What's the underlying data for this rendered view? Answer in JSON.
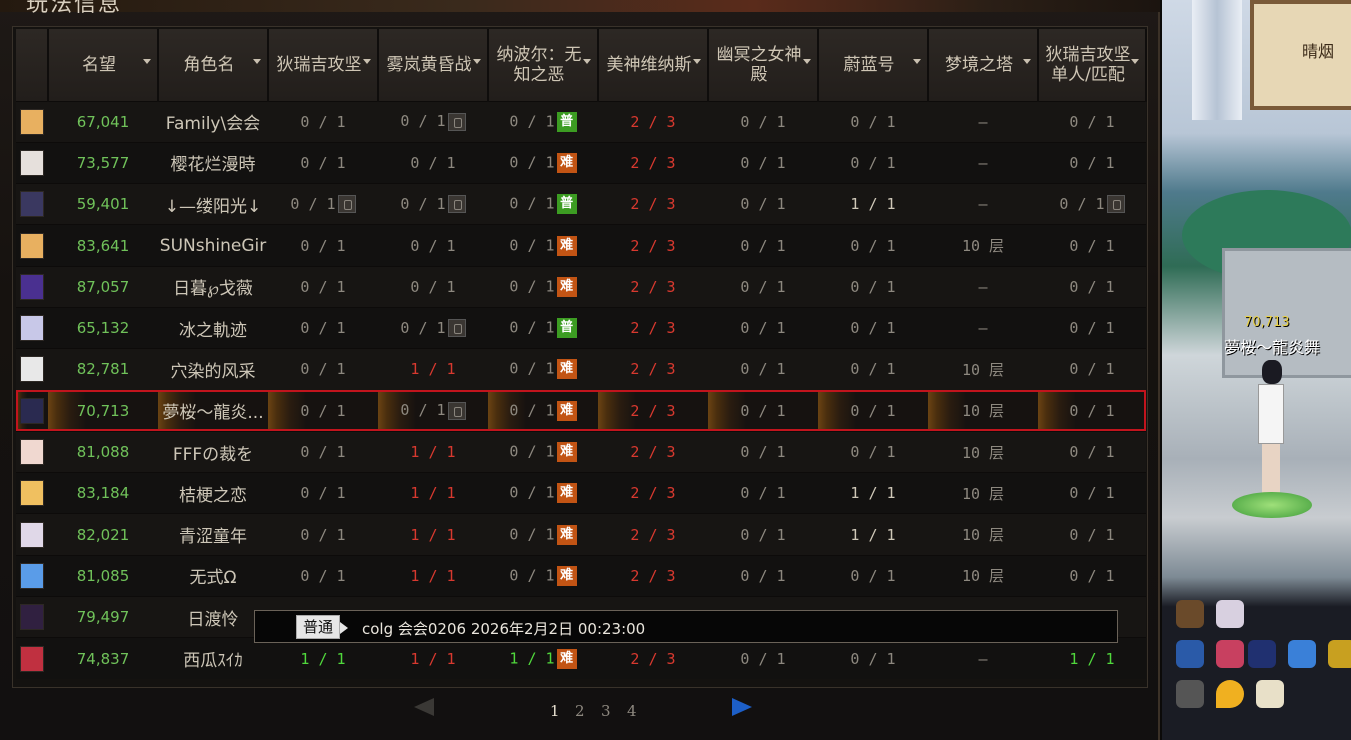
{
  "panel": {
    "title": "玩法信息"
  },
  "table": {
    "headers": [
      {
        "label": "",
        "name": "avatar"
      },
      {
        "label": "名望",
        "name": "fame"
      },
      {
        "label": "角色名",
        "name": "role-name"
      },
      {
        "label": "狄瑞吉攻坚",
        "name": "dirige-raid"
      },
      {
        "label": "雾岚黄昏战",
        "name": "mist-dusk"
      },
      {
        "label": "纳波尔：无知之恶",
        "name": "nabol"
      },
      {
        "label": "美神维纳斯",
        "name": "venus"
      },
      {
        "label": "幽冥之女神殿",
        "name": "nether-temple"
      },
      {
        "label": "蔚蓝号",
        "name": "azure"
      },
      {
        "label": "梦境之塔",
        "name": "dream-tower"
      },
      {
        "label": "狄瑞吉攻坚单人/匹配",
        "name": "dirige-solo"
      }
    ],
    "rows": [
      {
        "fame": "67,041",
        "name": "Family\\会会",
        "avatar_color": "#e8b060",
        "c1": {
          "v": "0 / 1"
        },
        "c2": {
          "v": "0 / 1",
          "lock": true
        },
        "c3": {
          "v": "0 / 1",
          "tag": "普",
          "tagType": "normal"
        },
        "c4": {
          "v": "2 / 3",
          "red": true
        },
        "c5": {
          "v": "0 / 1"
        },
        "c6": {
          "v": "0 / 1"
        },
        "c7": {
          "v": "–"
        },
        "c8": {
          "v": "0 / 1"
        }
      },
      {
        "fame": "73,577",
        "name": "樱花烂漫時",
        "avatar_color": "#e6e0dc",
        "c1": {
          "v": "0 / 1"
        },
        "c2": {
          "v": "0 / 1"
        },
        "c3": {
          "v": "0 / 1",
          "tag": "难",
          "tagType": "hard"
        },
        "c4": {
          "v": "2 / 3",
          "red": true
        },
        "c5": {
          "v": "0 / 1"
        },
        "c6": {
          "v": "0 / 1"
        },
        "c7": {
          "v": "–"
        },
        "c8": {
          "v": "0 / 1"
        }
      },
      {
        "fame": "59,401",
        "name": "↓—缕阳光↓",
        "avatar_color": "#3a3860",
        "c1": {
          "v": "0 / 1",
          "lock": true
        },
        "c2": {
          "v": "0 / 1",
          "lock": true
        },
        "c3": {
          "v": "0 / 1",
          "tag": "普",
          "tagType": "normal"
        },
        "c4": {
          "v": "2 / 3",
          "red": true
        },
        "c5": {
          "v": "0 / 1"
        },
        "c6": {
          "v": "1 / 1",
          "bright": true
        },
        "c7": {
          "v": "–"
        },
        "c8": {
          "v": "0 / 1",
          "lock": true
        }
      },
      {
        "fame": "83,641",
        "name": "SUNshineGir",
        "avatar_color": "#e8b060",
        "c1": {
          "v": "0 / 1"
        },
        "c2": {
          "v": "0 / 1"
        },
        "c3": {
          "v": "0 / 1",
          "tag": "难",
          "tagType": "hard"
        },
        "c4": {
          "v": "2 / 3",
          "red": true
        },
        "c5": {
          "v": "0 / 1"
        },
        "c6": {
          "v": "0 / 1"
        },
        "c7": {
          "v": "10 层"
        },
        "c8": {
          "v": "0 / 1"
        }
      },
      {
        "fame": "87,057",
        "name": "日暮℘戈薇",
        "avatar_color": "#4a3090",
        "c1": {
          "v": "0 / 1"
        },
        "c2": {
          "v": "0 / 1"
        },
        "c3": {
          "v": "0 / 1",
          "tag": "难",
          "tagType": "hard"
        },
        "c4": {
          "v": "2 / 3",
          "red": true
        },
        "c5": {
          "v": "0 / 1"
        },
        "c6": {
          "v": "0 / 1"
        },
        "c7": {
          "v": "–"
        },
        "c8": {
          "v": "0 / 1"
        }
      },
      {
        "fame": "65,132",
        "name": "冰之軌迹",
        "avatar_color": "#c8c8e8",
        "c1": {
          "v": "0 / 1"
        },
        "c2": {
          "v": "0 / 1",
          "lock": true
        },
        "c3": {
          "v": "0 / 1",
          "tag": "普",
          "tagType": "normal"
        },
        "c4": {
          "v": "2 / 3",
          "red": true
        },
        "c5": {
          "v": "0 / 1"
        },
        "c6": {
          "v": "0 / 1"
        },
        "c7": {
          "v": "–"
        },
        "c8": {
          "v": "0 / 1"
        }
      },
      {
        "fame": "82,781",
        "name": "穴染的风采",
        "avatar_color": "#e8e8e8",
        "c1": {
          "v": "0 / 1"
        },
        "c2": {
          "v": "1 / 1",
          "red": true
        },
        "c3": {
          "v": "0 / 1",
          "tag": "难",
          "tagType": "hard"
        },
        "c4": {
          "v": "2 / 3",
          "red": true
        },
        "c5": {
          "v": "0 / 1"
        },
        "c6": {
          "v": "0 / 1"
        },
        "c7": {
          "v": "10 层"
        },
        "c8": {
          "v": "0 / 1"
        }
      },
      {
        "fame": "70,713",
        "name": "夢桜～龍炎...",
        "avatar_color": "#2a2a50",
        "selected": true,
        "c1": {
          "v": "0 / 1"
        },
        "c2": {
          "v": "0 / 1",
          "lock": true
        },
        "c3": {
          "v": "0 / 1",
          "tag": "难",
          "tagType": "hard"
        },
        "c4": {
          "v": "2 / 3",
          "red": true
        },
        "c5": {
          "v": "0 / 1"
        },
        "c6": {
          "v": "0 / 1"
        },
        "c7": {
          "v": "10 层"
        },
        "c8": {
          "v": "0 / 1"
        }
      },
      {
        "fame": "81,088",
        "name": "FFFの裁を",
        "avatar_color": "#f0d8d0",
        "c1": {
          "v": "0 / 1"
        },
        "c2": {
          "v": "1 / 1",
          "red": true
        },
        "c3": {
          "v": "0 / 1",
          "tag": "难",
          "tagType": "hard"
        },
        "c4": {
          "v": "2 / 3",
          "red": true
        },
        "c5": {
          "v": "0 / 1"
        },
        "c6": {
          "v": "0 / 1"
        },
        "c7": {
          "v": "10 层"
        },
        "c8": {
          "v": "0 / 1"
        }
      },
      {
        "fame": "83,184",
        "name": "桔梗之恋",
        "avatar_color": "#f0c060",
        "c1": {
          "v": "0 / 1"
        },
        "c2": {
          "v": "1 / 1",
          "red": true
        },
        "c3": {
          "v": "0 / 1",
          "tag": "难",
          "tagType": "hard"
        },
        "c4": {
          "v": "2 / 3",
          "red": true
        },
        "c5": {
          "v": "0 / 1"
        },
        "c6": {
          "v": "1 / 1",
          "bright": true
        },
        "c7": {
          "v": "10 层"
        },
        "c8": {
          "v": "0 / 1"
        }
      },
      {
        "fame": "82,021",
        "name": "青涩童年",
        "avatar_color": "#e0d8e8",
        "c1": {
          "v": "0 / 1"
        },
        "c2": {
          "v": "1 / 1",
          "red": true
        },
        "c3": {
          "v": "0 / 1",
          "tag": "难",
          "tagType": "hard"
        },
        "c4": {
          "v": "2 / 3",
          "red": true
        },
        "c5": {
          "v": "0 / 1"
        },
        "c6": {
          "v": "1 / 1",
          "bright": true
        },
        "c7": {
          "v": "10 层"
        },
        "c8": {
          "v": "0 / 1"
        }
      },
      {
        "fame": "81,085",
        "name": "无式Ω",
        "avatar_color": "#5a9ce8",
        "c1": {
          "v": "0 / 1"
        },
        "c2": {
          "v": "1 / 1",
          "red": true
        },
        "c3": {
          "v": "0 / 1",
          "tag": "难",
          "tagType": "hard"
        },
        "c4": {
          "v": "2 / 3",
          "red": true
        },
        "c5": {
          "v": "0 / 1"
        },
        "c6": {
          "v": "0 / 1"
        },
        "c7": {
          "v": "10 层"
        },
        "c8": {
          "v": "0 / 1"
        }
      },
      {
        "fame": "79,497",
        "name": "日渡怜",
        "avatar_color": "#302040",
        "hidden": true,
        "c1": {
          "v": ""
        },
        "c2": {
          "v": ""
        },
        "c3": {
          "v": ""
        },
        "c4": {
          "v": ""
        },
        "c5": {
          "v": ""
        },
        "c6": {
          "v": ""
        },
        "c7": {
          "v": ""
        },
        "c8": {
          "v": ""
        }
      },
      {
        "fame": "74,837",
        "name": "西瓜ｽｲｶ",
        "avatar_color": "#c03040",
        "c1": {
          "v": "1 / 1",
          "green": true
        },
        "c2": {
          "v": "1 / 1",
          "red": true
        },
        "c3": {
          "v": "1 / 1",
          "green": true,
          "tag": "难",
          "tagType": "hard"
        },
        "c4": {
          "v": "2 / 3",
          "red": true
        },
        "c5": {
          "v": "0 / 1"
        },
        "c6": {
          "v": "0 / 1"
        },
        "c7": {
          "v": "–"
        },
        "c8": {
          "v": "1 / 1",
          "green": true
        }
      }
    ]
  },
  "chat": {
    "channel": "普通",
    "message": "colg 会会0206 2026年2月2日 00:23:00"
  },
  "pagination": {
    "pages": [
      "1",
      "2",
      "3",
      "4"
    ],
    "current": "1"
  },
  "scene": {
    "sign_text": "晴烟",
    "player_fame": "70,713",
    "player_name": "夢桜～龍炎舞"
  },
  "colors": {
    "accent_red": "#c2141d",
    "fame_green": "#70c25a",
    "hard_tag": "#c25414",
    "normal_tag": "#3c9c22"
  }
}
